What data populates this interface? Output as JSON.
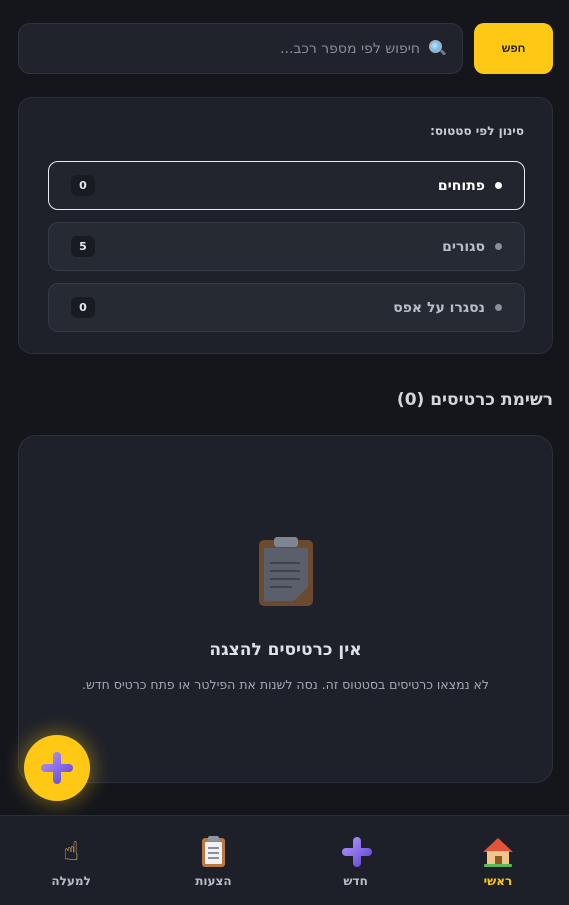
{
  "search": {
    "placeholder": "חיפוש לפי מספר רכב...",
    "button_label": "חפש"
  },
  "filter": {
    "title": "סינון לפי סטטוס:",
    "options": [
      {
        "label": "פתוחים",
        "count": "0",
        "active": true
      },
      {
        "label": "סגורים",
        "count": "5",
        "active": false
      },
      {
        "label": "נסגרו על אפס",
        "count": "0",
        "active": false
      }
    ]
  },
  "list": {
    "title": "רשימת כרטיסים (0)"
  },
  "empty_state": {
    "title": "אין כרטיסים להצגה",
    "description": "לא נמצאו כרטיסים בסטטוס זה. נסה לשנות את הפילטר או פתח כרטיס חדש.",
    "icon": "clipboard-icon"
  },
  "fab": {
    "icon": "plus-icon"
  },
  "bottom_nav": {
    "items": [
      {
        "label": "ראשי",
        "icon": "house-icon",
        "active": true
      },
      {
        "label": "חדש",
        "icon": "plus-icon",
        "active": false
      },
      {
        "label": "הצעות",
        "icon": "clipboard-icon",
        "active": false
      },
      {
        "label": "למעלה",
        "icon": "pointing-up-hand-icon",
        "active": false
      }
    ]
  },
  "colors": {
    "background": "#14161c",
    "card": "#1e2129",
    "accent": "#ffc814"
  }
}
